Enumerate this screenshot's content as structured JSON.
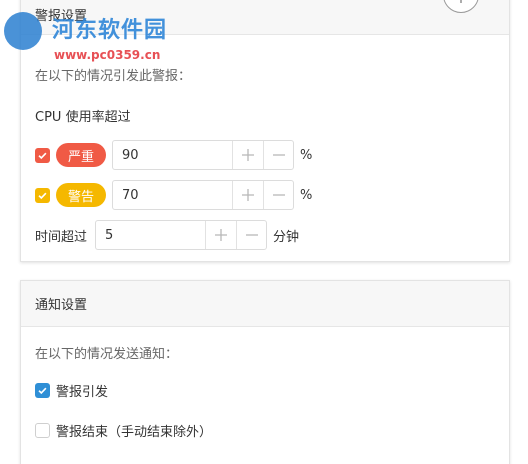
{
  "alarm": {
    "title": "警报设置",
    "hint": "在以下的情况引发此警报：",
    "cpu_label": "CPU 使用率超过",
    "rows": [
      {
        "tag": "严重",
        "value": "90",
        "unit": "%"
      },
      {
        "tag": "警告",
        "value": "70",
        "unit": "%"
      }
    ],
    "duration": {
      "label": "时间超过",
      "value": "5",
      "unit": "分钟"
    }
  },
  "notify": {
    "title": "通知设置",
    "hint": "在以下的情况发送通知：",
    "options": [
      {
        "label": "警报引发",
        "checked": true
      },
      {
        "label": "警报结束（手动结束除外）",
        "checked": false
      }
    ]
  },
  "watermark": {
    "title": "河东软件园",
    "url": "www.pc0359.cn"
  },
  "colors": {
    "critical": "#f05a45",
    "warning": "#f5b800",
    "checkbox_blue": "#2f8fd6"
  },
  "icons": [
    "checkmark-icon",
    "plus-icon",
    "minus-icon",
    "add-circle-icon",
    "site-logo-icon"
  ]
}
